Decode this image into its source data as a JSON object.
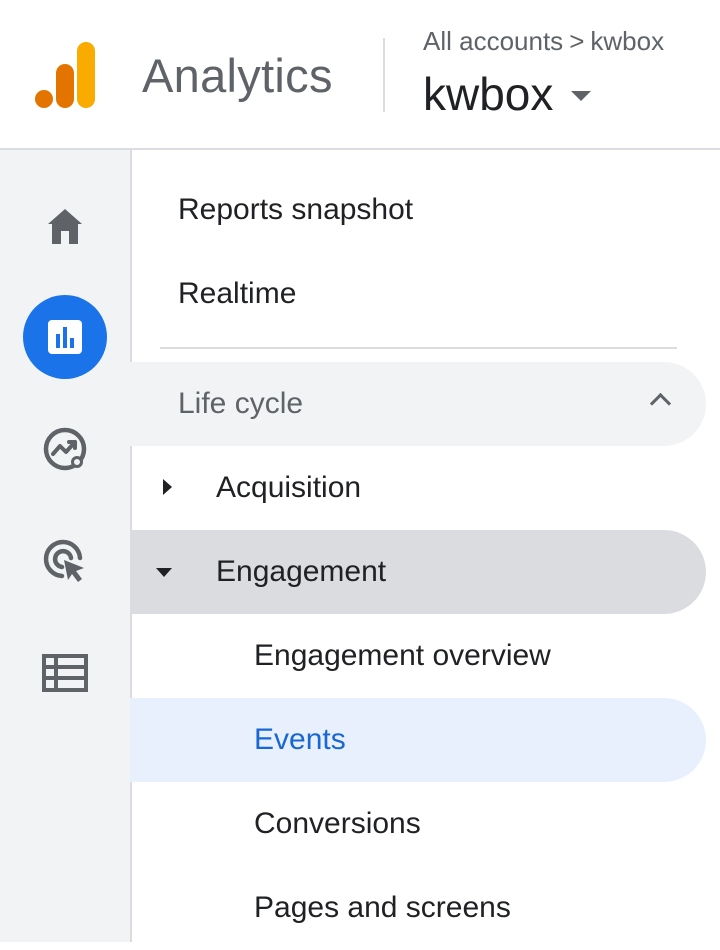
{
  "header": {
    "product_name": "Analytics",
    "breadcrumb": {
      "root": "All accounts",
      "separator": ">",
      "current": "kwbox"
    },
    "property": "kwbox",
    "logo_colors": [
      "#F9AB00",
      "#E37400"
    ]
  },
  "rail": {
    "items": [
      {
        "icon": "home-icon",
        "active": false
      },
      {
        "icon": "reports-icon",
        "active": true
      },
      {
        "icon": "explore-icon",
        "active": false
      },
      {
        "icon": "advertising-icon",
        "active": false
      },
      {
        "icon": "configure-icon",
        "active": false
      }
    ],
    "accent": "#1a73e8"
  },
  "nav": {
    "reports_snapshot": "Reports snapshot",
    "realtime": "Realtime",
    "section": {
      "label": "Life cycle",
      "expanded": true,
      "groups": [
        {
          "label": "Acquisition",
          "expanded": false
        },
        {
          "label": "Engagement",
          "expanded": true,
          "items": [
            {
              "label": "Engagement overview",
              "selected": false
            },
            {
              "label": "Events",
              "selected": true
            },
            {
              "label": "Conversions",
              "selected": false
            },
            {
              "label": "Pages and screens",
              "selected": false
            }
          ]
        }
      ]
    },
    "selected_color": "#1967d2",
    "selected_bg": "#e8f0fe"
  }
}
